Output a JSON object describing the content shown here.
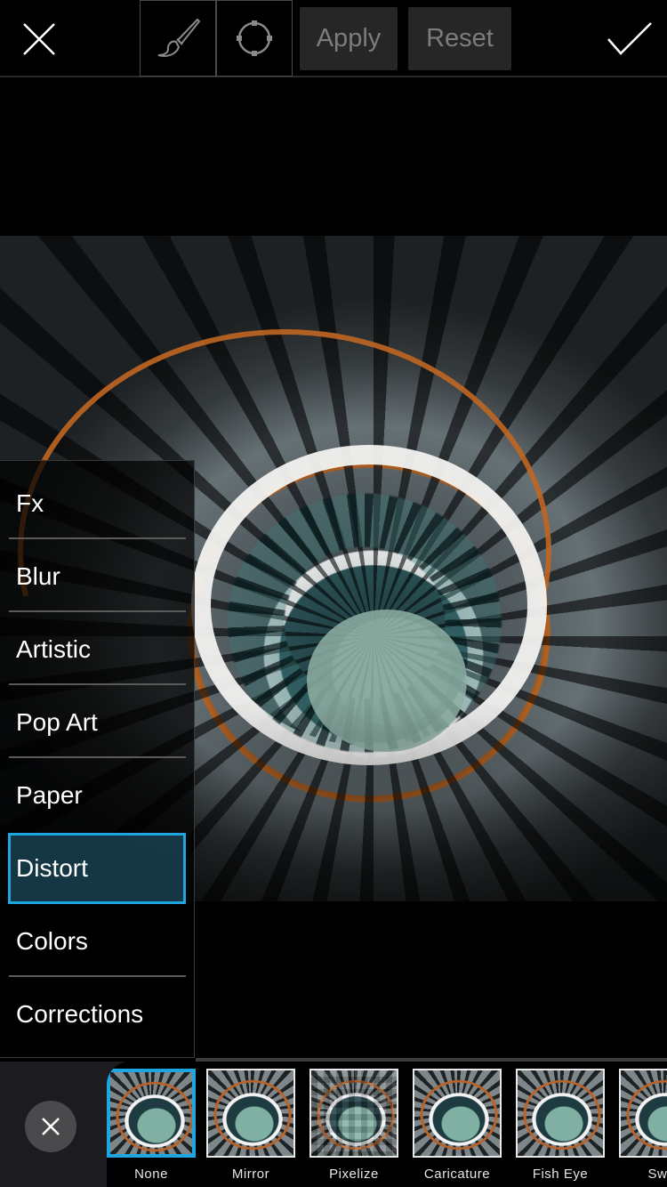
{
  "toolbar": {
    "close_icon": "close-icon",
    "brush_tool_icon": "brush-icon",
    "lasso_tool_icon": "circle-select-icon",
    "apply_label": "Apply",
    "reset_label": "Reset",
    "confirm_icon": "checkmark-icon"
  },
  "categories": {
    "items": [
      {
        "label": "Fx"
      },
      {
        "label": "Blur"
      },
      {
        "label": "Artistic"
      },
      {
        "label": "Pop Art"
      },
      {
        "label": "Paper"
      },
      {
        "label": "Distort"
      },
      {
        "label": "Colors"
      },
      {
        "label": "Corrections"
      }
    ],
    "selected": "Distort"
  },
  "effects": {
    "close_icon": "close-icon",
    "items": [
      {
        "label": "None"
      },
      {
        "label": "Mirror"
      },
      {
        "label": "Pixelize"
      },
      {
        "label": "Caricature"
      },
      {
        "label": "Fish Eye"
      },
      {
        "label": "Swirl"
      }
    ],
    "selected": "None"
  },
  "colors": {
    "accent": "#1fa6e0",
    "button_bg": "#262626",
    "button_text": "#7c7c7c"
  }
}
